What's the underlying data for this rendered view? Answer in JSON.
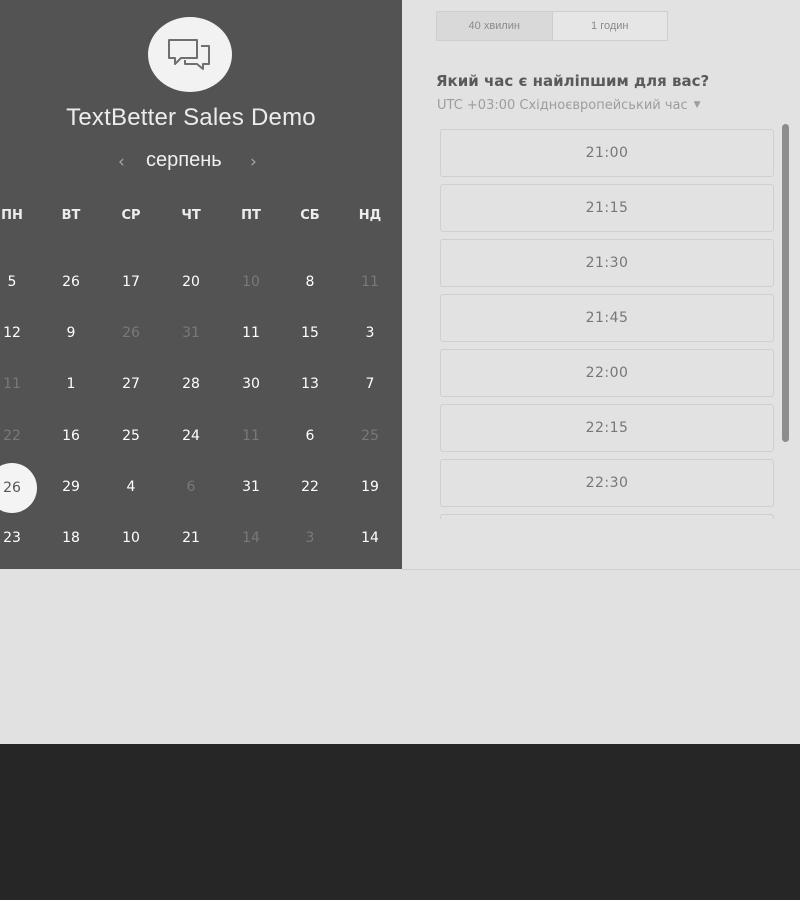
{
  "scheduler": {
    "title": "TextBetter Sales Demo",
    "logo_icon": "chat-bubbles-icon",
    "month": "серпень",
    "prev_icon": "chevron-left-icon",
    "next_icon": "chevron-right-icon"
  },
  "calendar": {
    "weekdays": [
      "ПН",
      "ВТ",
      "СР",
      "ЧТ",
      "ПТ",
      "СБ",
      "НД"
    ],
    "weeks": [
      [
        {
          "d": "5",
          "dim": false
        },
        {
          "d": "26",
          "dim": false
        },
        {
          "d": "17",
          "dim": false
        },
        {
          "d": "20",
          "dim": false
        },
        {
          "d": "10",
          "dim": true
        },
        {
          "d": "8",
          "dim": false
        },
        {
          "d": "11",
          "dim": true
        }
      ],
      [
        {
          "d": "12",
          "dim": false
        },
        {
          "d": "9",
          "dim": false
        },
        {
          "d": "26",
          "dim": true
        },
        {
          "d": "31",
          "dim": true
        },
        {
          "d": "11",
          "dim": false
        },
        {
          "d": "15",
          "dim": false
        },
        {
          "d": "3",
          "dim": false
        }
      ],
      [
        {
          "d": "11",
          "dim": true
        },
        {
          "d": "1",
          "dim": false
        },
        {
          "d": "27",
          "dim": false
        },
        {
          "d": "28",
          "dim": false
        },
        {
          "d": "30",
          "dim": false
        },
        {
          "d": "13",
          "dim": false
        },
        {
          "d": "7",
          "dim": false
        }
      ],
      [
        {
          "d": "22",
          "dim": true
        },
        {
          "d": "16",
          "dim": false
        },
        {
          "d": "25",
          "dim": false
        },
        {
          "d": "24",
          "dim": false
        },
        {
          "d": "11",
          "dim": true
        },
        {
          "d": "6",
          "dim": false
        },
        {
          "d": "25",
          "dim": true
        }
      ],
      [
        {
          "d": "26",
          "dim": false,
          "selected": true
        },
        {
          "d": "29",
          "dim": false
        },
        {
          "d": "4",
          "dim": false
        },
        {
          "d": "6",
          "dim": true
        },
        {
          "d": "31",
          "dim": false
        },
        {
          "d": "22",
          "dim": false
        },
        {
          "d": "19",
          "dim": false
        }
      ],
      [
        {
          "d": "23",
          "dim": false
        },
        {
          "d": "18",
          "dim": false
        },
        {
          "d": "10",
          "dim": false
        },
        {
          "d": "21",
          "dim": false
        },
        {
          "d": "14",
          "dim": true
        },
        {
          "d": "3",
          "dim": true
        },
        {
          "d": "14",
          "dim": false
        }
      ]
    ]
  },
  "duration": {
    "options": [
      "40 хвилин",
      "1 годин"
    ],
    "selected": "40 хвилин"
  },
  "time_picker": {
    "question": "Який час є найліпшим для вас?",
    "timezone": "UTC +03:00 Східноєвропейський час",
    "timezone_icon": "caret-down-icon",
    "slots": [
      "21:00",
      "21:15",
      "21:30",
      "21:45",
      "22:00",
      "22:15",
      "22:30",
      ""
    ]
  }
}
